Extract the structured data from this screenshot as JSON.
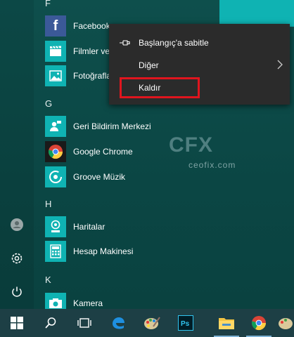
{
  "sections": {
    "f": "F",
    "g": "G",
    "h": "H",
    "k": "K"
  },
  "apps": {
    "facebook": "Facebook",
    "filmler": "Filmler ve",
    "fotograflar": "Fotoğrafla",
    "geri_bildirim": "Geri Bildirim Merkezi",
    "google_chrome": "Google Chrome",
    "groove": "Groove Müzik",
    "haritalar": "Haritalar",
    "hesap_makinesi": "Hesap Makinesi",
    "kamera": "Kamera"
  },
  "context_menu": {
    "pin": "Başlangıç'a sabitle",
    "more": "Diğer",
    "uninstall": "Kaldır"
  },
  "watermark": {
    "logo": "CFX",
    "url": "ceofix.com"
  },
  "colors": {
    "tile_blue": "#0fb3b3",
    "facebook_blue": "#3b5998",
    "highlight_red": "#e0151e",
    "menu_bg": "#2b2b2b",
    "taskbar_bg": "#1d3f45"
  },
  "icons": {
    "rail": [
      "user-icon",
      "settings-icon",
      "power-icon"
    ],
    "taskbar": [
      "windows-start-icon",
      "search-icon",
      "task-view-icon",
      "edge-icon",
      "paint-icon",
      "photoshop-icon",
      "file-explorer-icon",
      "chrome-icon",
      "paint-icon"
    ]
  }
}
